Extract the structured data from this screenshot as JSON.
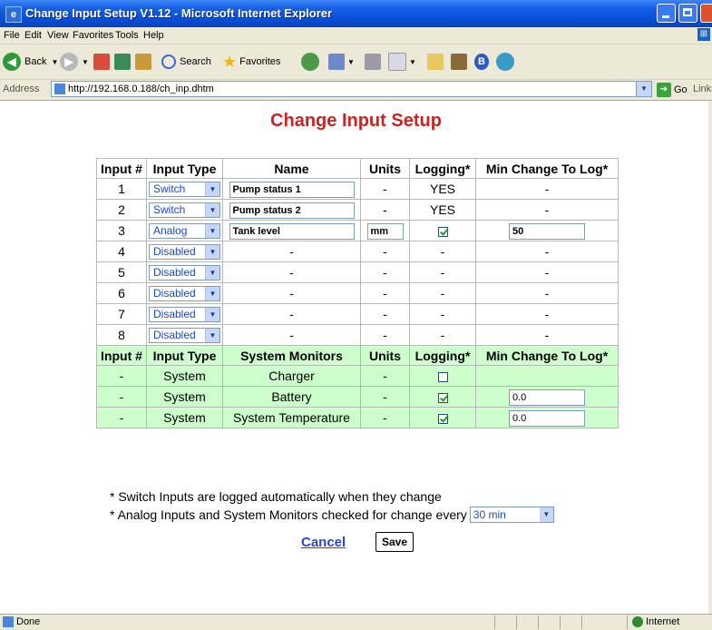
{
  "window": {
    "title": "Change Input Setup V1.12 - Microsoft Internet Explorer"
  },
  "menu": [
    "File",
    "Edit",
    "View",
    "Favorites",
    "Tools",
    "Help"
  ],
  "toolbar": {
    "back_label": "Back",
    "search_label": "Search",
    "favorites_label": "Favorites"
  },
  "address": {
    "label": "Address",
    "url": "http://192.168.0.188/ch_inp.dhtm",
    "go_label": "Go",
    "links_label": "Links"
  },
  "page": {
    "title": "Change Input Setup"
  },
  "inputs_table": {
    "headers": [
      "Input #",
      "Input Type",
      "Name",
      "Units",
      "Logging*",
      "Min Change To Log*"
    ],
    "rows": [
      {
        "num": "1",
        "type": "Switch",
        "name": "Pump status 1",
        "units": "-",
        "logging": "YES",
        "min_change": "-"
      },
      {
        "num": "2",
        "type": "Switch",
        "name": "Pump status 2",
        "units": "-",
        "logging": "YES",
        "min_change": "-"
      },
      {
        "num": "3",
        "type": "Analog",
        "name": "Tank level",
        "units": "mm",
        "logging": "checked",
        "min_change": "50"
      },
      {
        "num": "4",
        "type": "Disabled",
        "name": "-",
        "units": "-",
        "logging": "-",
        "min_change": "-"
      },
      {
        "num": "5",
        "type": "Disabled",
        "name": "-",
        "units": "-",
        "logging": "-",
        "min_change": "-"
      },
      {
        "num": "6",
        "type": "Disabled",
        "name": "-",
        "units": "-",
        "logging": "-",
        "min_change": "-"
      },
      {
        "num": "7",
        "type": "Disabled",
        "name": "-",
        "units": "-",
        "logging": "-",
        "min_change": "-"
      },
      {
        "num": "8",
        "type": "Disabled",
        "name": "-",
        "units": "-",
        "logging": "-",
        "min_change": "-"
      }
    ]
  },
  "monitors_table": {
    "headers": [
      "Input #",
      "Input Type",
      "System Monitors",
      "Units",
      "Logging*",
      "Min Change To Log*"
    ],
    "rows": [
      {
        "num": "-",
        "type": "System",
        "name": "Charger",
        "units": "-",
        "logging": false,
        "min_change": ""
      },
      {
        "num": "-",
        "type": "System",
        "name": "Battery",
        "units": "-",
        "logging": true,
        "min_change": "0.0"
      },
      {
        "num": "-",
        "type": "System",
        "name": "System Temperature",
        "units": "-",
        "logging": true,
        "min_change": "0.0"
      }
    ]
  },
  "notes": {
    "line1": "* Switch Inputs are logged automatically when they change",
    "line2": "* Analog Inputs and System Monitors checked for change every",
    "interval": "30 min"
  },
  "actions": {
    "cancel": "Cancel",
    "save": "Save"
  },
  "status": {
    "text": "Done",
    "zone": "Internet"
  }
}
